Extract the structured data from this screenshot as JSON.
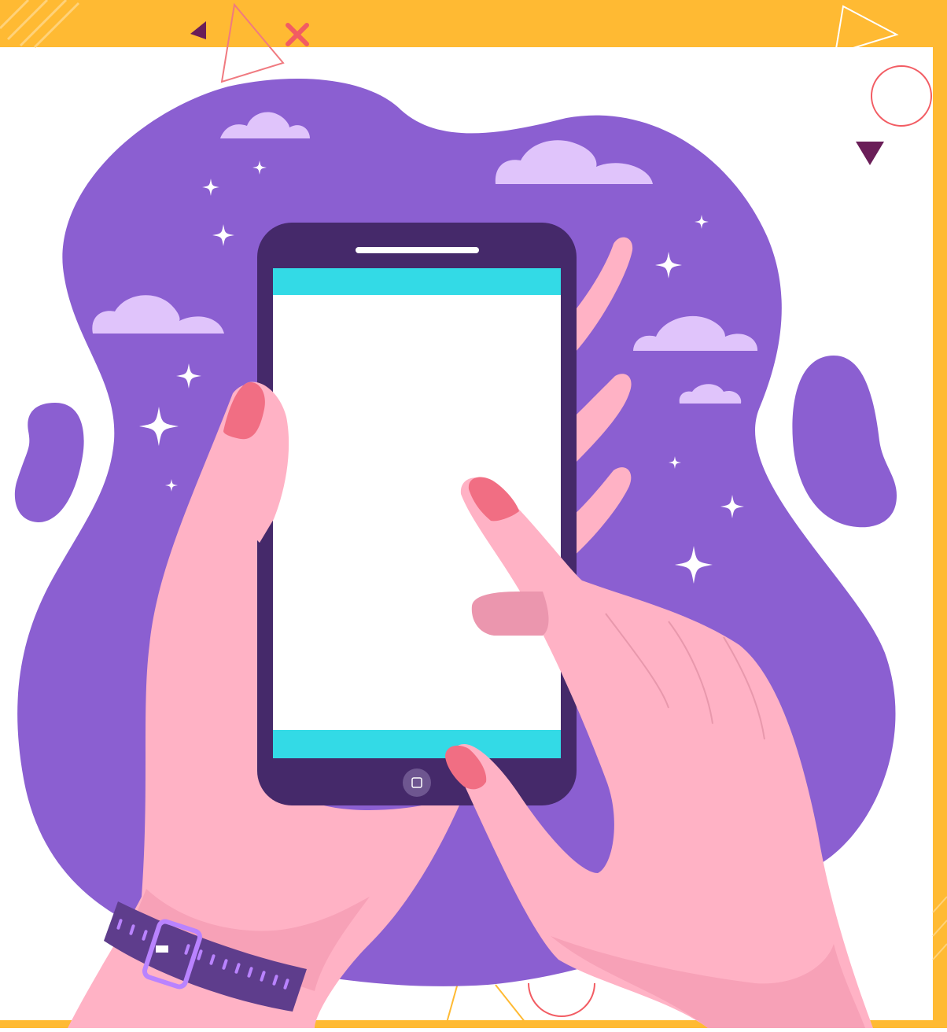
{
  "illustration": {
    "subject": "hands-holding-smartphone",
    "palette": {
      "frame": "#FFBA33",
      "background": "#FFFFFF",
      "blob": "#8B5FD1",
      "cloud": "#E0C4FB",
      "sparkle": "#FFFFFF",
      "phone_body": "#45296A",
      "phone_bar": "#33DAE6",
      "phone_screen": "#FFFFFF",
      "skin": "#FFB2C5",
      "skin_shadow": "#F7A1B7",
      "nail": "#F16E83",
      "watch_band": "#5E3D8C",
      "watch_accent": "#B983FF",
      "accent_red": "#F25C63",
      "accent_dark": "#6A1E58"
    },
    "icons": [
      "cloud-icon",
      "sparkle-icon",
      "triangle-icon",
      "cross-icon",
      "circle-icon",
      "home-button-icon"
    ]
  }
}
